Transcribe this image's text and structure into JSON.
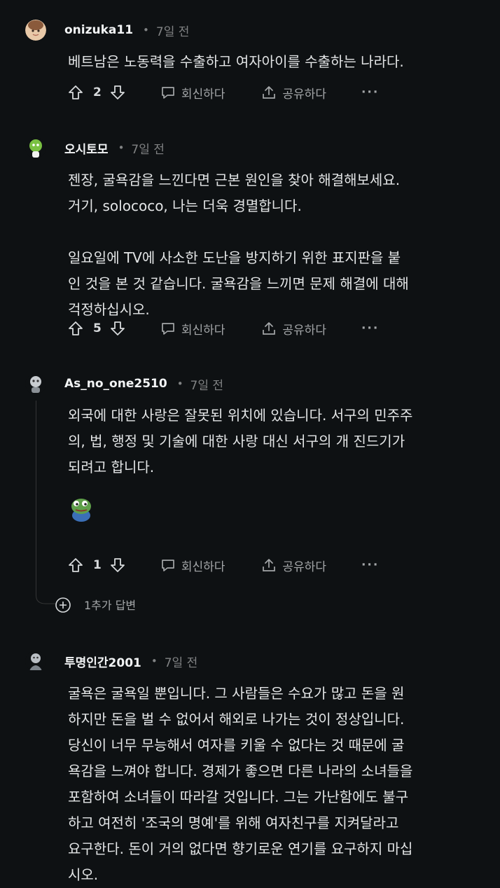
{
  "comments": [
    {
      "username": "onizuka11",
      "time": "7일 전",
      "avatar_icon": "avatar-face-icon",
      "body": "베트남은 노동력을 수출하고 여자아이를 수출하는 나라다.",
      "votes": "2",
      "reply_label": "회신하다",
      "share_label": "공유하다",
      "more_label": "···"
    },
    {
      "username": "오시토모",
      "time": "7일 전",
      "avatar_icon": "avatar-green-character-icon",
      "body": "젠장, 굴욕감을 느낀다면 근본 원인을 찾아 해결해보세요.\n거기, solococo, 나는 더욱 경멸합니다.\n\n일요일에 TV에 사소한 도난을 방지하기 위한 표지판을 붙\n인 것을 본 것 같습니다. 굴욕감을 느끼면 문제 해결에 대해\n걱정하십시오.",
      "votes": "5",
      "reply_label": "회신하다",
      "share_label": "공유하다",
      "more_label": "···"
    },
    {
      "username": "As_no_one2510",
      "time": "7일 전",
      "avatar_icon": "avatar-grey-character-icon",
      "body": "외국에 대한 사랑은 잘못된 위치에 있습니다. 서구의 민주주\n의, 법, 행정 및 기술에 대한 사랑 대신 서구의 개 진드기가\n되려고 합니다.",
      "sticker_icon": "frog-sticker-icon",
      "votes": "1",
      "reply_label": "회신하다",
      "share_label": "공유하다",
      "more_label": "···",
      "more_replies": "1추가 답변"
    },
    {
      "username": "투명인간2001",
      "time": "7일 전",
      "avatar_icon": "avatar-grey-figure-icon",
      "body": "굴욕은 굴욕일 뿐입니다. 그 사람들은 수요가 많고 돈을 원\n하지만 돈을 벌 수 없어서 해외로 나가는 것이 정상입니다.\n당신이 너무 무능해서 여자를 키울 수 없다는 것 때문에 굴\n욕감을 느껴야 합니다. 경제가 좋으면 다른 나라의 소녀들을\n포함하여 소녀들이 따라갈 것입니다. 그는 가난함에도 불구\n하고 여전히 '조국의 명예'를 위해 여자친구를 지켜달라고\n요구한다. 돈이 거의 없다면 향기로운 연기를 요구하지 마십\n시오."
    }
  ],
  "colors": {
    "background": "#0e1113",
    "text": "#e3e5e6",
    "muted": "#818384",
    "thread_line": "#343536"
  }
}
